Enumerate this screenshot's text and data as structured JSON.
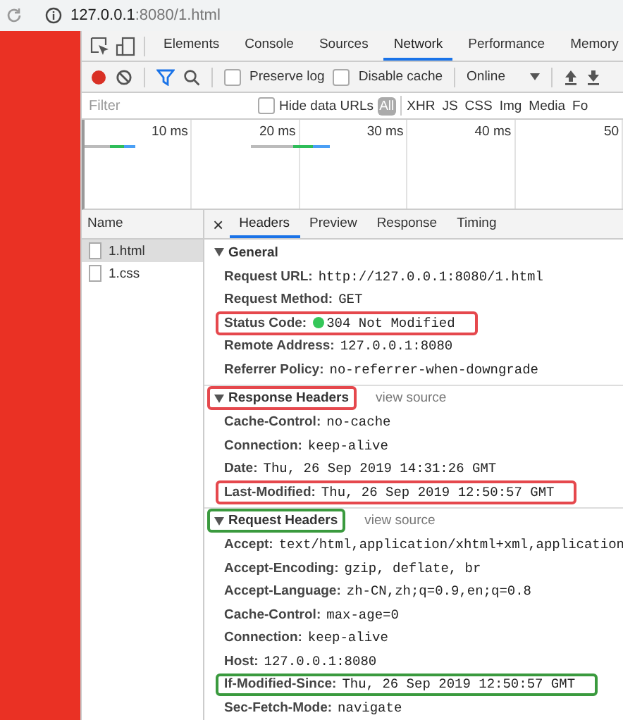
{
  "address_bar": {
    "host": "127.0.0.1",
    "rest": ":8080/1.html"
  },
  "tabs": [
    {
      "label": "Elements",
      "selected": false
    },
    {
      "label": "Console",
      "selected": false
    },
    {
      "label": "Sources",
      "selected": false
    },
    {
      "label": "Network",
      "selected": true
    },
    {
      "label": "Performance",
      "selected": false
    },
    {
      "label": "Memory",
      "selected": false
    }
  ],
  "toolbar": {
    "recording": true,
    "preserve_log": {
      "label": "Preserve log",
      "checked": false
    },
    "disable_cache": {
      "label": "Disable cache",
      "checked": false
    },
    "throttling": "Online"
  },
  "filter": {
    "placeholder": "Filter",
    "hide_data_urls": {
      "label": "Hide data URLs",
      "checked": false
    },
    "types": [
      {
        "label": "All",
        "selected": true
      },
      {
        "label": "XHR",
        "selected": false
      },
      {
        "label": "JS",
        "selected": false
      },
      {
        "label": "CSS",
        "selected": false
      },
      {
        "label": "Img",
        "selected": false
      },
      {
        "label": "Media",
        "selected": false
      },
      {
        "label": "Fo",
        "selected": false
      }
    ]
  },
  "timeline": {
    "ticks": [
      "10 ms",
      "20 ms",
      "30 ms",
      "40 ms",
      "50"
    ]
  },
  "requests": {
    "header": "Name",
    "items": [
      {
        "name": "1.html",
        "selected": true
      },
      {
        "name": "1.css",
        "selected": false
      }
    ]
  },
  "detail_tabs": {
    "close": "×",
    "tabs": [
      {
        "label": "Headers",
        "selected": true
      },
      {
        "label": "Preview",
        "selected": false
      },
      {
        "label": "Response",
        "selected": false
      },
      {
        "label": "Timing",
        "selected": false
      }
    ]
  },
  "sections": [
    {
      "title": "General",
      "expanded": true,
      "rows": [
        {
          "key": "Request URL:",
          "value": "http://127.0.0.1:8080/1.html"
        },
        {
          "key": "Request Method:",
          "value": "GET"
        },
        {
          "key": "Status Code:",
          "value": "304 Not Modified",
          "status": {
            "color": "#34c759"
          },
          "color": "#e5484d"
        },
        {
          "key": "Remote Address:",
          "value": "127.0.0.1:8080"
        },
        {
          "key": "Referrer Policy:",
          "value": "no-referrer-when-downgrade"
        }
      ]
    },
    {
      "title": "Response Headers",
      "expanded": true,
      "color": "#e5484d",
      "view_source": "view source",
      "rows": [
        {
          "key": "Cache-Control:",
          "value": "no-cache"
        },
        {
          "key": "Connection:",
          "value": "keep-alive"
        },
        {
          "key": "Date:",
          "value": "Thu, 26 Sep 2019 14:31:26 GMT"
        },
        {
          "key": "Last-Modified:",
          "value": "Thu, 26 Sep 2019 12:50:57 GMT",
          "color": "#e5484d"
        }
      ]
    },
    {
      "title": "Request Headers",
      "expanded": true,
      "color": "#3a9a3e",
      "view_source": "view source",
      "rows": [
        {
          "key": "Accept:",
          "value": "text/html,application/xhtml+xml,application"
        },
        {
          "key": "Accept-Encoding:",
          "value": "gzip, deflate, br"
        },
        {
          "key": "Accept-Language:",
          "value": "zh-CN,zh;q=0.9,en;q=0.8"
        },
        {
          "key": "Cache-Control:",
          "value": "max-age=0"
        },
        {
          "key": "Connection:",
          "value": "keep-alive"
        },
        {
          "key": "Host:",
          "value": "127.0.0.1:8080"
        },
        {
          "key": "If-Modified-Since:",
          "value": "Thu, 26 Sep 2019 12:50:57 GMT",
          "color": "#3a9a3e"
        },
        {
          "key": "Sec-Fetch-Mode:",
          "value": "navigate"
        }
      ]
    }
  ]
}
